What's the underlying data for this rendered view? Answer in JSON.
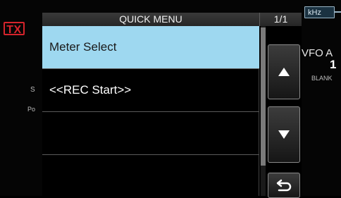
{
  "background": {
    "tx_label": "TX",
    "meter_s": "S",
    "meter_po": "Po",
    "khz_label": "kHz",
    "vfo_label": "VFO A",
    "vfo_number": "1",
    "blank_label": "BLANK"
  },
  "quick_menu": {
    "title": "QUICK MENU",
    "page": "1/1",
    "items": [
      {
        "label": "Meter Select",
        "selected": true
      },
      {
        "label": "<<REC Start>>",
        "selected": false
      },
      {
        "label": "",
        "selected": false
      },
      {
        "label": "",
        "selected": false
      }
    ],
    "scroll": {
      "up_icon": "triangle-up",
      "down_icon": "triangle-down",
      "back_icon": "return-arrow"
    }
  },
  "colors": {
    "selected_row": "#9ed8f0",
    "tx_red": "#d6242c",
    "background": "#000000"
  }
}
